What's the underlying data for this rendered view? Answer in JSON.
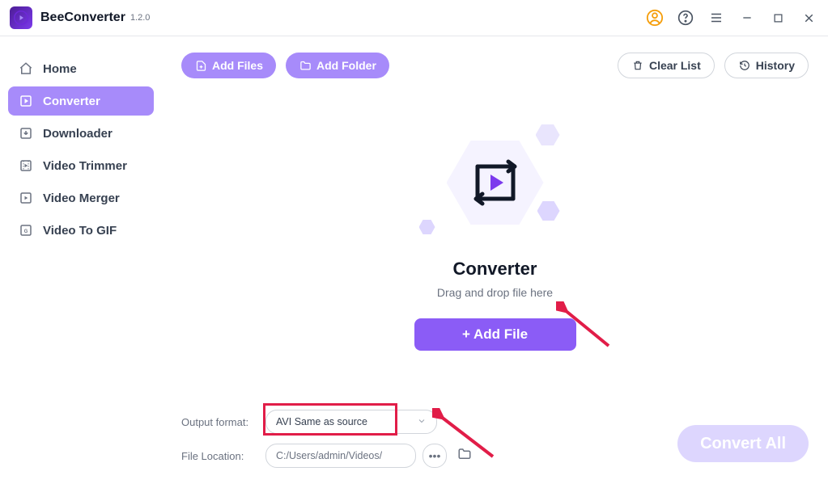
{
  "app": {
    "name": "BeeConverter",
    "version": "1.2.0"
  },
  "sidebar": {
    "items": [
      {
        "label": "Home",
        "icon": "home-icon"
      },
      {
        "label": "Converter",
        "icon": "convert-icon",
        "active": true
      },
      {
        "label": "Downloader",
        "icon": "download-icon"
      },
      {
        "label": "Video Trimmer",
        "icon": "trimmer-icon"
      },
      {
        "label": "Video Merger",
        "icon": "merger-icon"
      },
      {
        "label": "Video To GIF",
        "icon": "gif-icon"
      }
    ]
  },
  "toolbar": {
    "add_files_label": "Add Files",
    "add_folder_label": "Add Folder",
    "clear_list_label": "Clear List",
    "history_label": "History"
  },
  "dropzone": {
    "title": "Converter",
    "subtitle": "Drag and drop file here",
    "add_file_btn": "+ Add File"
  },
  "bottom": {
    "output_format_label": "Output format:",
    "output_format_value": "AVI Same as source",
    "file_location_label": "File Location:",
    "file_location_value": "C:/Users/admin/Videos/",
    "convert_all_label": "Convert All"
  }
}
